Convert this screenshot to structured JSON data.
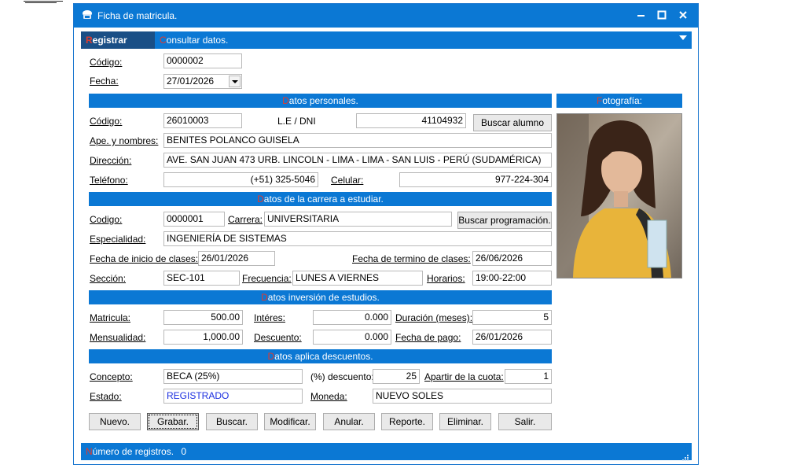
{
  "window": {
    "title": "Ficha de matricula."
  },
  "tabs": [
    {
      "first": "R",
      "rest": "egistrar datos."
    },
    {
      "first": "C",
      "rest": "onsultar datos."
    }
  ],
  "top": {
    "codigo_label": "Código:",
    "codigo_value": "0000002",
    "fecha_label": "Fecha:",
    "fecha_value": "27/01/2026"
  },
  "personal": {
    "section": {
      "first": "D",
      "rest": "atos personales."
    },
    "codigo_label": "Código:",
    "codigo_value": "26010003",
    "dni_label": "L.E / DNI",
    "dni_value": "41104932",
    "buscar_alumno": "Buscar alumno",
    "nombres_label": "Ape. y nombres:",
    "nombres_value": "BENITES POLANCO GUISELA",
    "direccion_label": "Dirección:",
    "direccion_value": "AVE. SAN JUAN 473 URB. LINCOLN - LIMA - LIMA - SAN LUIS - PERÚ (SUDAMÉRICA)",
    "telefono_label": "Teléfono:",
    "telefono_value": "(+51) 325-5046",
    "celular_label": "Celular:",
    "celular_value": "977-224-304"
  },
  "photo": {
    "section": {
      "first": "F",
      "rest": "otografía:"
    }
  },
  "carrera": {
    "section": {
      "first": "D",
      "rest": "atos de la carrera a estudiar."
    },
    "codigo_label": "Codigo:",
    "codigo_value": "0000001",
    "carrera_label": "Carrera:",
    "carrera_value": "UNIVERSITARIA",
    "buscar_programacion": "Buscar programación.",
    "especialidad_label": "Especialidad:",
    "especialidad_value": "INGENIERÍA DE SISTEMAS",
    "inicio_label": "Fecha de inicio de clases:",
    "inicio_value": "26/01/2026",
    "termino_label": "Fecha de termino de clases:",
    "termino_value": "26/06/2026",
    "seccion_label": "Sección:",
    "seccion_value": "SEC-101",
    "frecuencia_label": "Frecuencia:",
    "frecuencia_value": "LUNES A VIERNES",
    "horarios_label": "Horarios:",
    "horarios_value": "19:00-22:00"
  },
  "inversion": {
    "section": {
      "first": "D",
      "rest": "atos inversión de estudios."
    },
    "matricula_label": "Matricula:",
    "matricula_value": "500.00",
    "interes_label": "Intéres:",
    "interes_value": "0.000",
    "duracion_label": "Duración (meses):",
    "duracion_value": "5",
    "mensualidad_label": "Mensualidad:",
    "mensualidad_value": "1,000.00",
    "descuento_label": "Descuento:",
    "descuento_value": "0.000",
    "pago_label": "Fecha de pago:",
    "pago_value": "26/01/2026"
  },
  "descuentos": {
    "section": {
      "first": "D",
      "rest": "atos aplica descuentos."
    },
    "concepto_label": "Concepto:",
    "concepto_value": "BECA (25%)",
    "porc_label": "(%) descuento:",
    "porc_value": "25",
    "cuota_label": "Apartir de la cuota:",
    "cuota_value": "1",
    "estado_label": "Estado:",
    "estado_value": "REGISTRADO",
    "moneda_label": "Moneda:",
    "moneda_value": "NUEVO SOLES"
  },
  "buttons": [
    "Nuevo.",
    "Grabar.",
    "Buscar.",
    "Modificar.",
    "Anular.",
    "Reporte.",
    "Eliminar.",
    "Salir."
  ],
  "status": {
    "first": "N",
    "rest": "úmero de registros.",
    "count": "0"
  },
  "colors": {
    "accent": "#0b78d4",
    "red_mnemonic": "#e03b2e",
    "estado_text": "#1c2fe0"
  }
}
